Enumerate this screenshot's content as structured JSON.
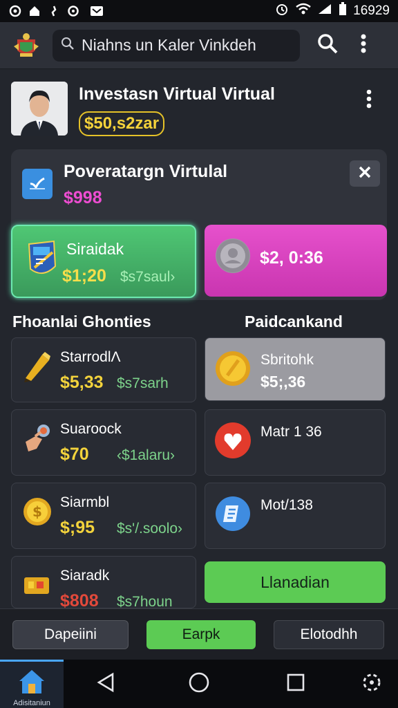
{
  "status_bar": {
    "time": "16929"
  },
  "app_bar": {
    "search_value": "Niahns un Kaler Vinkdeh"
  },
  "profile": {
    "name": "Investasn Virtual Virtual",
    "balance": "$50,s2zar"
  },
  "portfolio": {
    "title": "Poveratargn Virtulal",
    "value": "$998"
  },
  "featured": {
    "green": {
      "title": "Siraidak",
      "value": "$1;20",
      "sub": "$s7saul›"
    },
    "pink": {
      "value": "$2, 0:36"
    }
  },
  "sections": {
    "left": "Fhoanlai Ghonties",
    "right": "Paidcankand"
  },
  "tiles_left": [
    {
      "title": "StarrodlΛ",
      "value": "$5,33",
      "sub": "$s7sarh"
    },
    {
      "title": "Suaroock",
      "value": "$70",
      "sub": "‹$1alaru›"
    },
    {
      "title": "Siarmbl",
      "value": "$;95",
      "sub": "$s'/.soolo›"
    },
    {
      "title": "Siaradk",
      "value": "$808",
      "sub": "$s7houn"
    }
  ],
  "tiles_right": [
    {
      "title": "Sbritohk",
      "value": "$5;,36"
    },
    {
      "title": "Matr 1 36"
    },
    {
      "title": "Mot/138"
    }
  ],
  "cta": {
    "label": "Llanadian"
  },
  "actions": {
    "deposit": "Dapeiini",
    "buy": "Earpk",
    "other": "Elotodhh"
  },
  "nav": {
    "home_label": "Adisitaniun"
  },
  "colors": {
    "green": "#4fc774",
    "pink": "#e651cc",
    "gold": "#f3d33c",
    "accent_blue": "#4aa7ff"
  }
}
